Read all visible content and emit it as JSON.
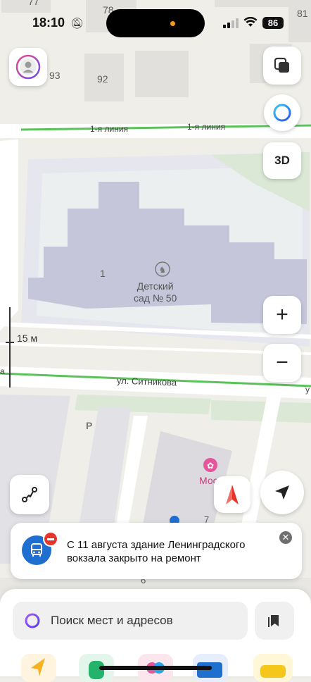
{
  "status_bar": {
    "time": "18:10",
    "battery": "86"
  },
  "map": {
    "house_numbers": [
      "77",
      "78",
      "93",
      "92",
      "81",
      "1",
      "6",
      "7",
      "P"
    ],
    "streets": {
      "line1_a": "1-я линия",
      "line1_b": "1-я линия",
      "sitnikova": "ул. Ситникова",
      "edge_left": "а",
      "edge_right": "у"
    },
    "poi": {
      "name_line1": "Детский",
      "name_line2": "сад № 50",
      "shop": "Мос"
    },
    "scale": "15 м"
  },
  "controls": {
    "layers_icon": "layers-icon",
    "assistant_icon": "alice-icon",
    "mode_3d": "3D",
    "zoom_in": "+",
    "zoom_out": "−"
  },
  "notice": {
    "text": "С 11 августа здание Ленинградского вокзала закрыто на ремонт"
  },
  "bottom_sheet": {
    "search_placeholder": "Поиск мест и адресов"
  },
  "colors": {
    "street_green": "#5bc25b",
    "building": "#c6c6db",
    "accent_blue": "#1f6fd1",
    "notice_red": "#e6352b"
  }
}
